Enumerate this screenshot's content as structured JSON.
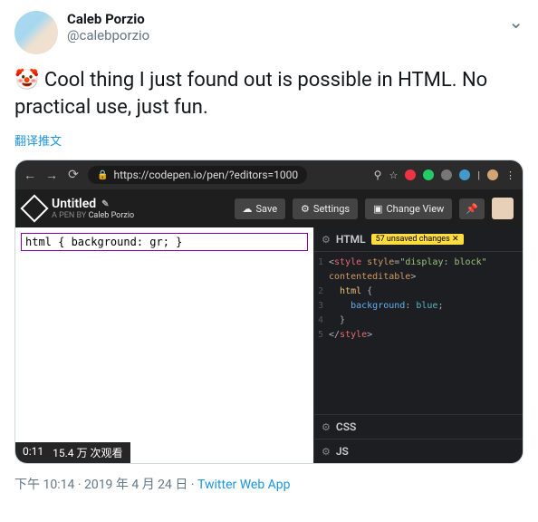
{
  "tweet": {
    "display_name": "Caleb Porzio",
    "handle": "@calebporzio",
    "text": "Cool thing I just found out is possible in  HTML. No practical use, just fun.",
    "emoji": "🤡",
    "translate_label": "翻译推文",
    "time": "下午 10:14",
    "date": "2019 年 4 月 24 日",
    "app": "Twitter Web App"
  },
  "browser": {
    "url": "https://codepen.io/pen/?editors=1000"
  },
  "codepen": {
    "title": "Untitled",
    "byline_prefix": "A PEN BY",
    "byline_author": "Caleb Porzio",
    "save_label": "Save",
    "settings_label": "Settings",
    "change_view_label": "Change View"
  },
  "preview": {
    "editable_text": "html { background: gr; }"
  },
  "editor": {
    "tab_html": "HTML",
    "tab_css": "CSS",
    "tab_js": "JS",
    "unsaved_badge": "57 unsaved changes ✕",
    "lines": {
      "l1a": "<style",
      "l1b": "style=",
      "l1c": "\"display: block\"",
      "l1cont": "contenteditable",
      "l1d": ">",
      "l2a": "html",
      "l2b": " {",
      "l3a": "background",
      "l3b": ": ",
      "l3c": "blue",
      "l3d": ";",
      "l4": "}",
      "l5a": "</style>"
    }
  },
  "video": {
    "timestamp": "0:11",
    "views": "15.4 万 次观看"
  }
}
